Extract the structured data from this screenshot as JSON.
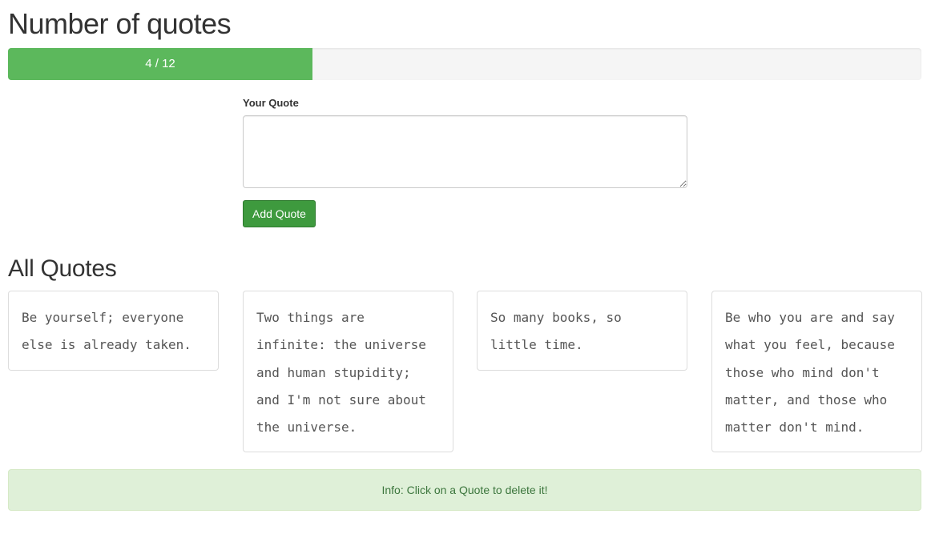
{
  "header": {
    "title": "Number of quotes"
  },
  "progress": {
    "label": "4 / 12",
    "current": 4,
    "max": 12
  },
  "form": {
    "label": "Your Quote",
    "value": "",
    "button_label": "Add Quote"
  },
  "quotes_section": {
    "title": "All Quotes",
    "items": [
      "Be yourself; everyone else is already taken.",
      "Two things are infinite: the universe and human stupidity; and I'm not sure about the universe.",
      "So many books, so little time.",
      "Be who you are and say what you feel, because those who mind don't matter, and those who matter don't mind."
    ]
  },
  "info": {
    "text": "Info: Click on a Quote to delete it!"
  },
  "colors": {
    "progress_fill": "#5cb85c",
    "button": "#3e9a3e",
    "info_bg": "#dff0d8",
    "info_text": "#3c763d"
  }
}
